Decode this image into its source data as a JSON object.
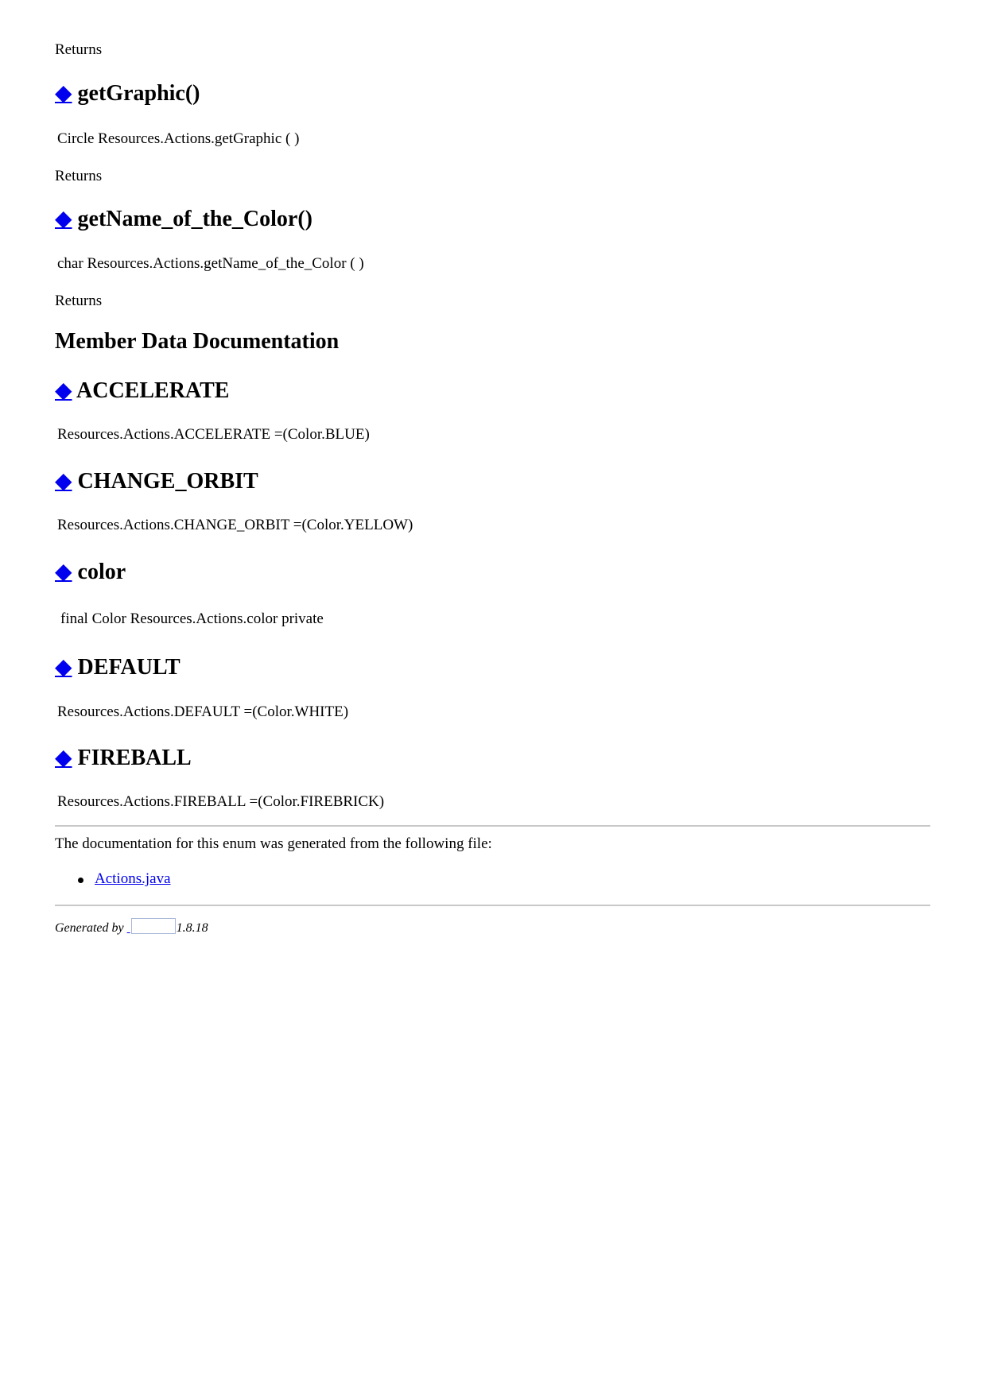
{
  "top_returns": "Returns",
  "sections": [
    {
      "anchor": "◆",
      "title": "getGraphic()",
      "signature": "Circle Resources.Actions.getGraphic (  )",
      "returns": "Returns"
    },
    {
      "anchor": "◆",
      "title": "getName_of_the_Color()",
      "signature": "char Resources.Actions.getName_of_the_Color (  )",
      "returns": "Returns"
    }
  ],
  "member_data_heading": "Member Data Documentation",
  "members": [
    {
      "anchor": "◆",
      "title": "ACCELERATE",
      "signature": "Resources.Actions.ACCELERATE =(Color.BLUE)"
    },
    {
      "anchor": "◆",
      "title": "CHANGE_ORBIT",
      "signature": "Resources.Actions.CHANGE_ORBIT =(Color.YELLOW)"
    },
    {
      "anchor": "◆",
      "title": "color",
      "signature": "final Color Resources.Actions.color private"
    },
    {
      "anchor": "◆",
      "title": "DEFAULT",
      "signature": "Resources.Actions.DEFAULT =(Color.WHITE)"
    },
    {
      "anchor": "◆",
      "title": "FIREBALL",
      "signature": "Resources.Actions.FIREBALL =(Color.FIREBRICK)"
    }
  ],
  "generated_note": "The documentation for this enum was generated from the following file:",
  "files": [
    "Actions.java"
  ],
  "footer": {
    "generated_by": "Generated by",
    "version": "1.8.18"
  }
}
